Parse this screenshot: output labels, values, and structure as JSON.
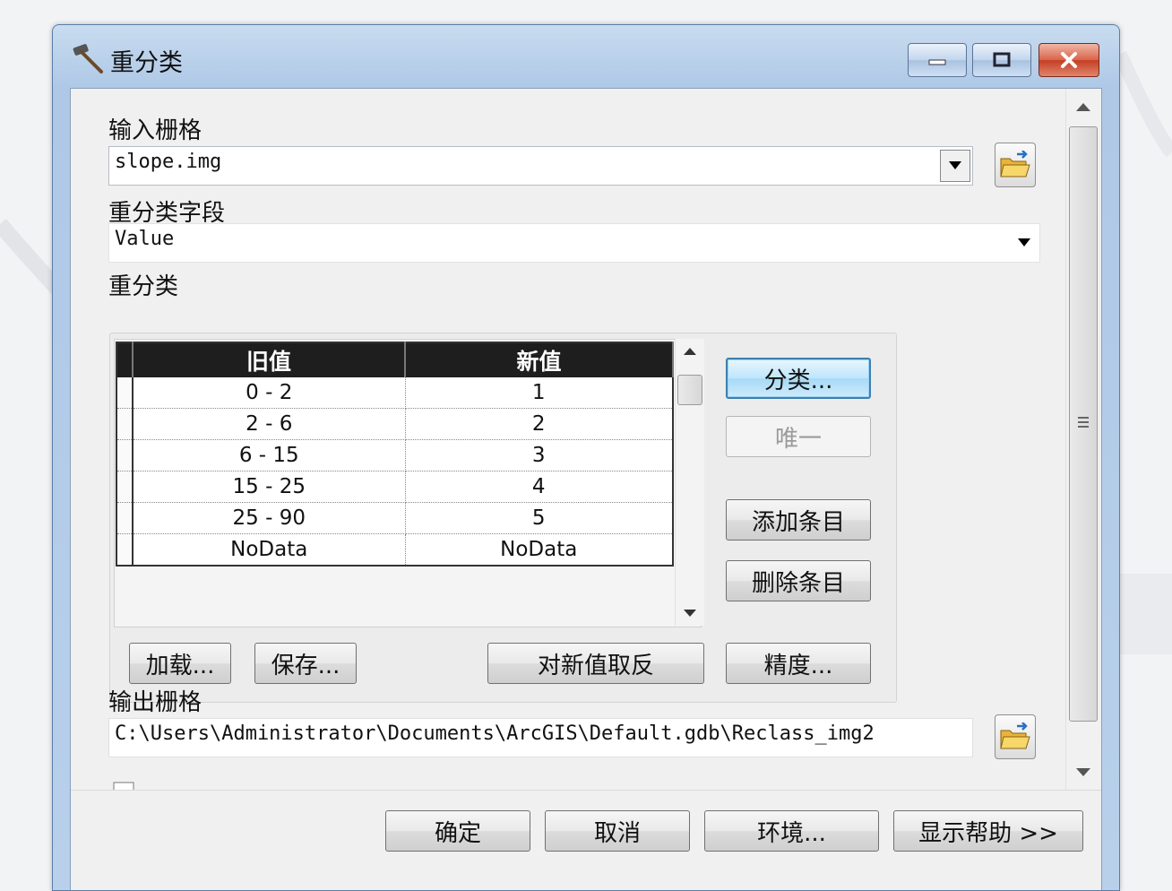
{
  "window": {
    "title": "重分类",
    "icon": "hammer-icon",
    "controls": [
      "minimize-icon",
      "maximize-icon",
      "close-icon"
    ]
  },
  "input_raster": {
    "label": "输入栅格",
    "value": "slope.img"
  },
  "reclass_field": {
    "label": "重分类字段",
    "value": "Value"
  },
  "reclassification": {
    "label": "重分类",
    "columns": [
      "旧值",
      "新值"
    ],
    "rows": [
      {
        "old": "0 - 2",
        "new": "1"
      },
      {
        "old": "2 - 6",
        "new": "2"
      },
      {
        "old": "6 - 15",
        "new": "3"
      },
      {
        "old": "15 - 25",
        "new": "4"
      },
      {
        "old": "25 - 90",
        "new": "5"
      },
      {
        "old": "NoData",
        "new": "NoData"
      }
    ],
    "buttons": {
      "classify": "分类...",
      "unique": "唯一",
      "add_entry": "添加条目",
      "delete_entry": "删除条目",
      "load": "加载...",
      "save": "保存...",
      "reverse": "对新值取反",
      "precision": "精度..."
    }
  },
  "output_raster": {
    "label": "输出栅格",
    "value": "C:\\Users\\Administrator\\Documents\\ArcGIS\\Default.gdb\\Reclass_img2"
  },
  "footer": {
    "ok": "确定",
    "cancel": "取消",
    "env": "环境...",
    "help": "显示帮助 >>"
  }
}
